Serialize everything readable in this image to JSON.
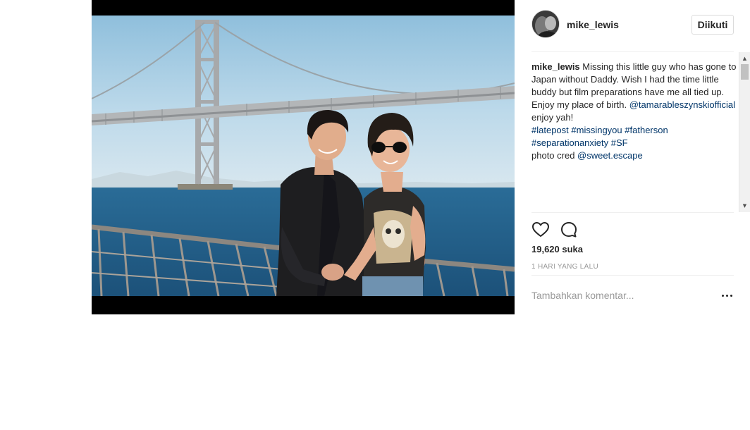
{
  "post": {
    "photo_alt": "Photo by mike_lewis",
    "author": {
      "username": "mike_lewis",
      "follow_label": "Diikuti"
    },
    "caption": {
      "username": "mike_lewis",
      "text_part1": " Missing this little guy who has gone to Japan without Daddy. Wish I had the time little buddy but film preparations have me all tied up. Enjoy my place of birth. ",
      "mention": "@tamarableszynskiofficial",
      "text_part2": " enjoy yah!",
      "hashtags": [
        "#latepost",
        "#missingyou",
        "#fatherson",
        "#separationanxiety",
        "#SF"
      ],
      "credit_label": "photo cred ",
      "credit_mention": "@sweet.escape"
    },
    "likes_count": "19,620",
    "likes_label": "suka",
    "timestamp": "1 HARI YANG LALU",
    "comment_placeholder": "Tambahkan komentar...",
    "icons": {
      "like": "heart-icon",
      "comment": "speech-bubble-icon",
      "more": "more-options-icon",
      "scroll_up": "scroll-up-arrow",
      "scroll_down": "scroll-down-arrow"
    },
    "colors": {
      "link": "#003569",
      "muted": "#999999",
      "text": "#262626",
      "border": "#dbdbdb"
    }
  }
}
